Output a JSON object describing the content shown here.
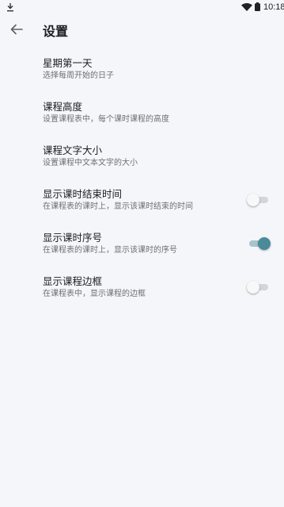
{
  "status_bar": {
    "time": "10:18",
    "icons": [
      "download-icon",
      "wifi-icon",
      "battery-icon"
    ]
  },
  "app_bar": {
    "title": "设置",
    "back_icon": "back-arrow-icon"
  },
  "colors": {
    "background": "#f4f6fa",
    "switch_on": "#4b8a99",
    "switch_off": "#d3d5d9"
  },
  "settings": [
    {
      "title": "星期第一天",
      "description": "选择每周开始的日子"
    },
    {
      "title": "课程高度",
      "description": "设置课程表中，每个课时课程的高度"
    },
    {
      "title": "课程文字大小",
      "description": "设置课程中文本文字的大小"
    },
    {
      "title": "显示课时结束时间",
      "description": "在课程表的课时上，显示该课时结束的时间",
      "switch": false
    },
    {
      "title": "显示课时序号",
      "description": "在课程表的课时上，显示该课时的序号",
      "switch": true
    },
    {
      "title": "显示课程边框",
      "description": "在课程表中，显示课程的边框",
      "switch": false
    }
  ]
}
